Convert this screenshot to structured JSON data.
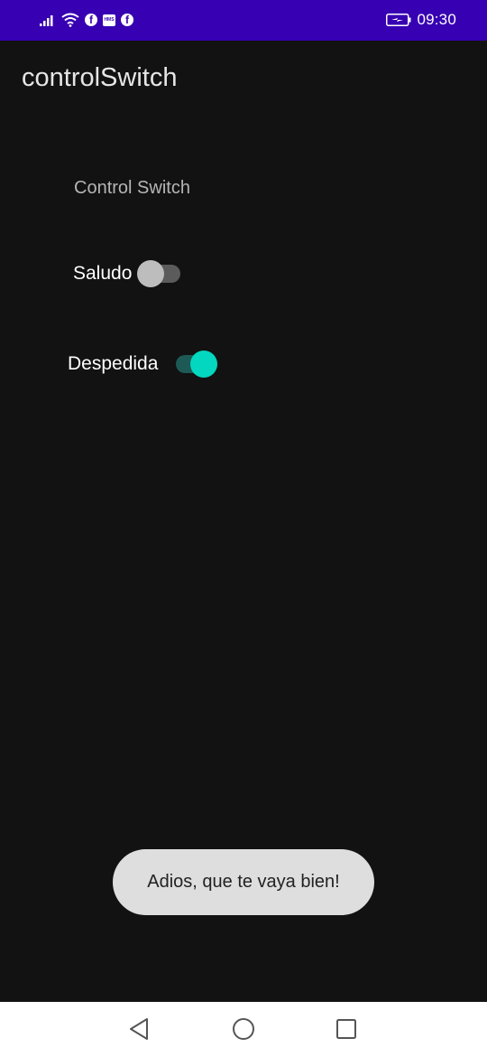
{
  "status_bar": {
    "time": "09:30",
    "icons": [
      "signal-icon",
      "wifi-icon",
      "facebook-icon",
      "huawei-mobile-services-icon",
      "facebook-icon",
      "battery-charging-icon"
    ],
    "facebook_glyph": "f",
    "hms_glyph": "HMS",
    "background_color": "#3700b3"
  },
  "app_bar": {
    "title": "controlSwitch"
  },
  "content": {
    "section_label": "Control Switch",
    "switches": [
      {
        "label": "Saludo",
        "checked": false
      },
      {
        "label": "Despedida",
        "checked": true
      }
    ],
    "accent_color": "#03d7bf"
  },
  "toast": {
    "message": "Adios, que te vaya bien!"
  },
  "nav_bar": {
    "buttons": [
      "back-icon",
      "home-icon",
      "recents-icon"
    ]
  }
}
